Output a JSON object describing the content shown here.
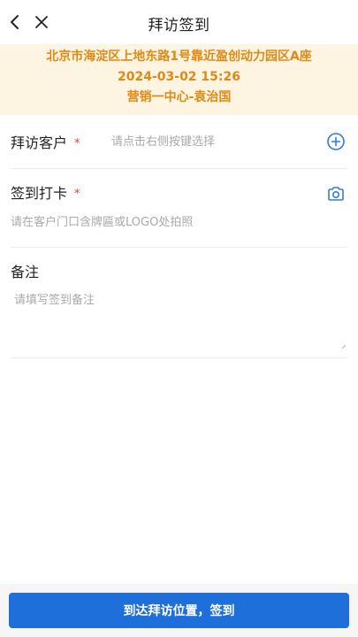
{
  "header": {
    "title": "拜访签到",
    "back_icon": "chevron-left-icon",
    "close_icon": "close-icon"
  },
  "location_banner": {
    "address": "北京市海淀区上地东路1号靠近盈创动力园区A座",
    "datetime": "2024-03-02 15:26",
    "department_user": "营销一中心-袁治国",
    "color": "#e08a16",
    "background": "#fdf4e1"
  },
  "form": {
    "customer": {
      "label": "拜访客户",
      "required_mark": "*",
      "placeholder": "请点击右侧按键选择",
      "icon": "add-circle-icon"
    },
    "checkin": {
      "label": "签到打卡",
      "required_mark": "*",
      "hint": "请在客户门口含牌匾或LOGO处拍照",
      "icon": "camera-icon"
    },
    "remark": {
      "label": "备注",
      "placeholder": "请填写签到备注",
      "value": ""
    }
  },
  "footer": {
    "submit_label": "到达拜访位置，签到"
  },
  "colors": {
    "primary": "#1e6fd9",
    "required": "#e23b3b",
    "icon": "#2f7be6"
  }
}
